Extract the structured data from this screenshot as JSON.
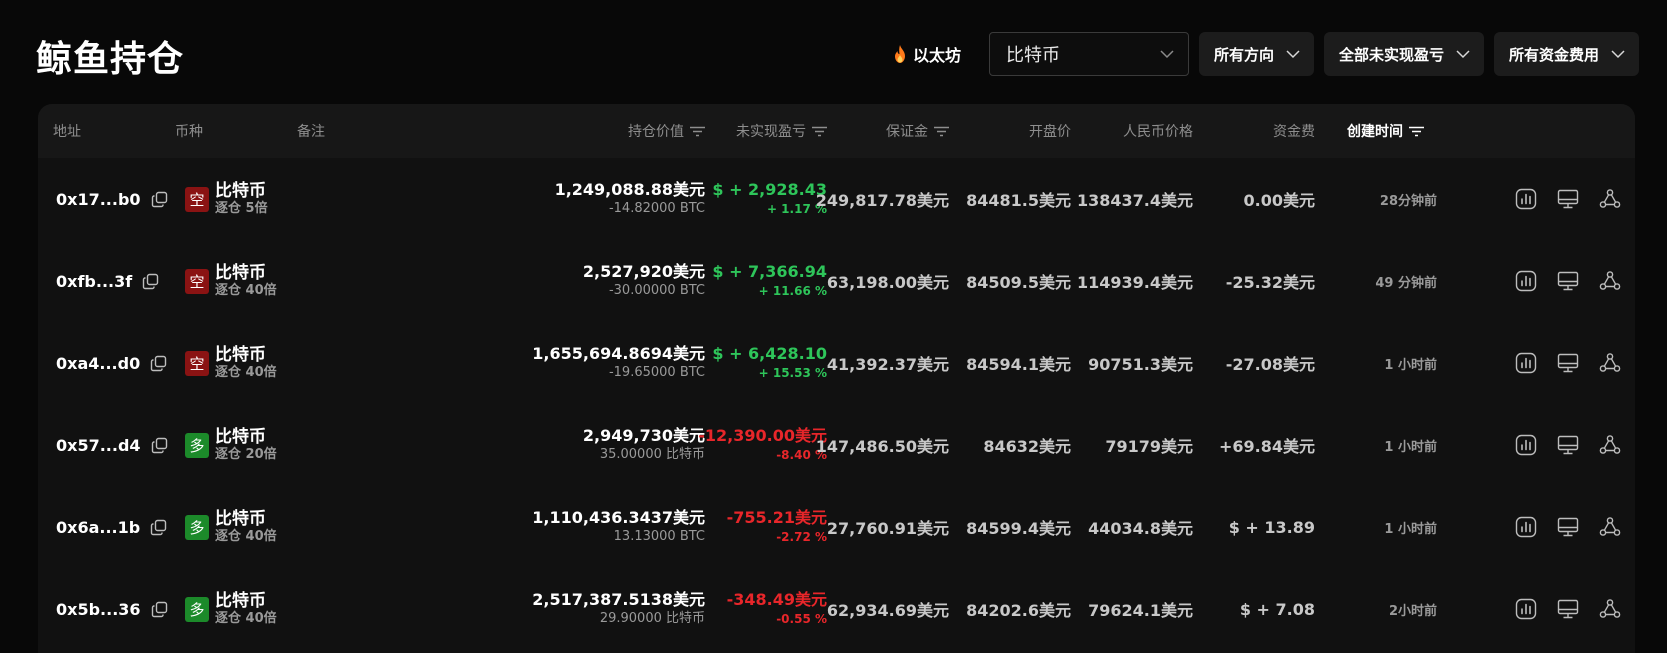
{
  "page": {
    "title": "鲸鱼持仓"
  },
  "filters": {
    "eth_label": "以太坊",
    "coin_select_value": "比特币",
    "direction_label": "所有方向",
    "pnl_label": "全部未实现盈亏",
    "fee_label": "所有资金费用"
  },
  "table": {
    "headers": {
      "address": "地址",
      "coin": "币种",
      "note": "备注",
      "value": "持仓价值",
      "pnl": "未实现盈亏",
      "margin": "保证金",
      "open_price": "开盘价",
      "cny_price": "人民币价格",
      "funding": "资金费",
      "created": "创建时间"
    },
    "rows": [
      {
        "address": "0x17...b0",
        "side": "空",
        "side_type": "short",
        "coin": "比特币",
        "leverage": "逐仓 5倍",
        "value": "1,249,088.88美元",
        "size": "-14.82000 BTC",
        "pnl": "$ + 2,928.43",
        "pnl_pct": "+ 1.17 %",
        "pnl_sign": "pos",
        "margin": "249,817.78美元",
        "open_price": "84481.5美元",
        "cny_price": "138437.4美元",
        "funding": "0.00美元",
        "funding_sign": "zero",
        "time": "28分钟前"
      },
      {
        "address": "0xfb...3f",
        "side": "空",
        "side_type": "short",
        "coin": "比特币",
        "leverage": "逐仓 40倍",
        "value": "2,527,920美元",
        "size": "-30.00000 BTC",
        "pnl": "$ + 7,366.94",
        "pnl_pct": "+ 11.66 %",
        "pnl_sign": "pos",
        "margin": "63,198.00美元",
        "open_price": "84509.5美元",
        "cny_price": "114939.4美元",
        "funding": "-25.32美元",
        "funding_sign": "neg",
        "time": "49 分钟前"
      },
      {
        "address": "0xa4...d0",
        "side": "空",
        "side_type": "short",
        "coin": "比特币",
        "leverage": "逐仓 40倍",
        "value": "1,655,694.8694美元",
        "size": "-19.65000 BTC",
        "pnl": "$ + 6,428.10",
        "pnl_pct": "+ 15.53 %",
        "pnl_sign": "pos",
        "margin": "41,392.37美元",
        "open_price": "84594.1美元",
        "cny_price": "90751.3美元",
        "funding": "-27.08美元",
        "funding_sign": "neg",
        "time": "1 小时前"
      },
      {
        "address": "0x57...d4",
        "side": "多",
        "side_type": "long",
        "coin": "比特币",
        "leverage": "逐仓 20倍",
        "value": "2,949,730美元",
        "size": "35.00000 比特币",
        "pnl": "-12,390.00美元",
        "pnl_pct": "-8.40 %",
        "pnl_sign": "neg",
        "margin": "147,486.50美元",
        "open_price": "84632美元",
        "cny_price": "79179美元",
        "funding": "+69.84美元",
        "funding_sign": "pos",
        "time": "1 小时前"
      },
      {
        "address": "0x6a...1b",
        "side": "多",
        "side_type": "long",
        "coin": "比特币",
        "leverage": "逐仓 40倍",
        "value": "1,110,436.3437美元",
        "size": "13.13000 BTC",
        "pnl": "-755.21美元",
        "pnl_pct": "-2.72 %",
        "pnl_sign": "neg",
        "margin": "27,760.91美元",
        "open_price": "84599.4美元",
        "cny_price": "44034.8美元",
        "funding": "$ + 13.89",
        "funding_sign": "pos",
        "time": "1 小时前"
      },
      {
        "address": "0x5b...36",
        "side": "多",
        "side_type": "long",
        "coin": "比特币",
        "leverage": "逐仓 40倍",
        "value": "2,517,387.5138美元",
        "size": "29.90000 比特币",
        "pnl": "-348.49美元",
        "pnl_pct": "-0.55 %",
        "pnl_sign": "neg",
        "margin": "62,934.69美元",
        "open_price": "84202.6美元",
        "cny_price": "79624.1美元",
        "funding": "$ + 7.08",
        "funding_sign": "pos",
        "time": "2小时前"
      }
    ]
  },
  "colors": {
    "positive": "#2ec55a",
    "negative": "#e8262a",
    "short_badge": "#8a1313",
    "long_badge": "#1c8a2a"
  },
  "icons": [
    "flame-icon",
    "chevron-down-icon",
    "filter-icon",
    "copy-icon",
    "chart-icon",
    "monitor-icon",
    "share-icon"
  ]
}
